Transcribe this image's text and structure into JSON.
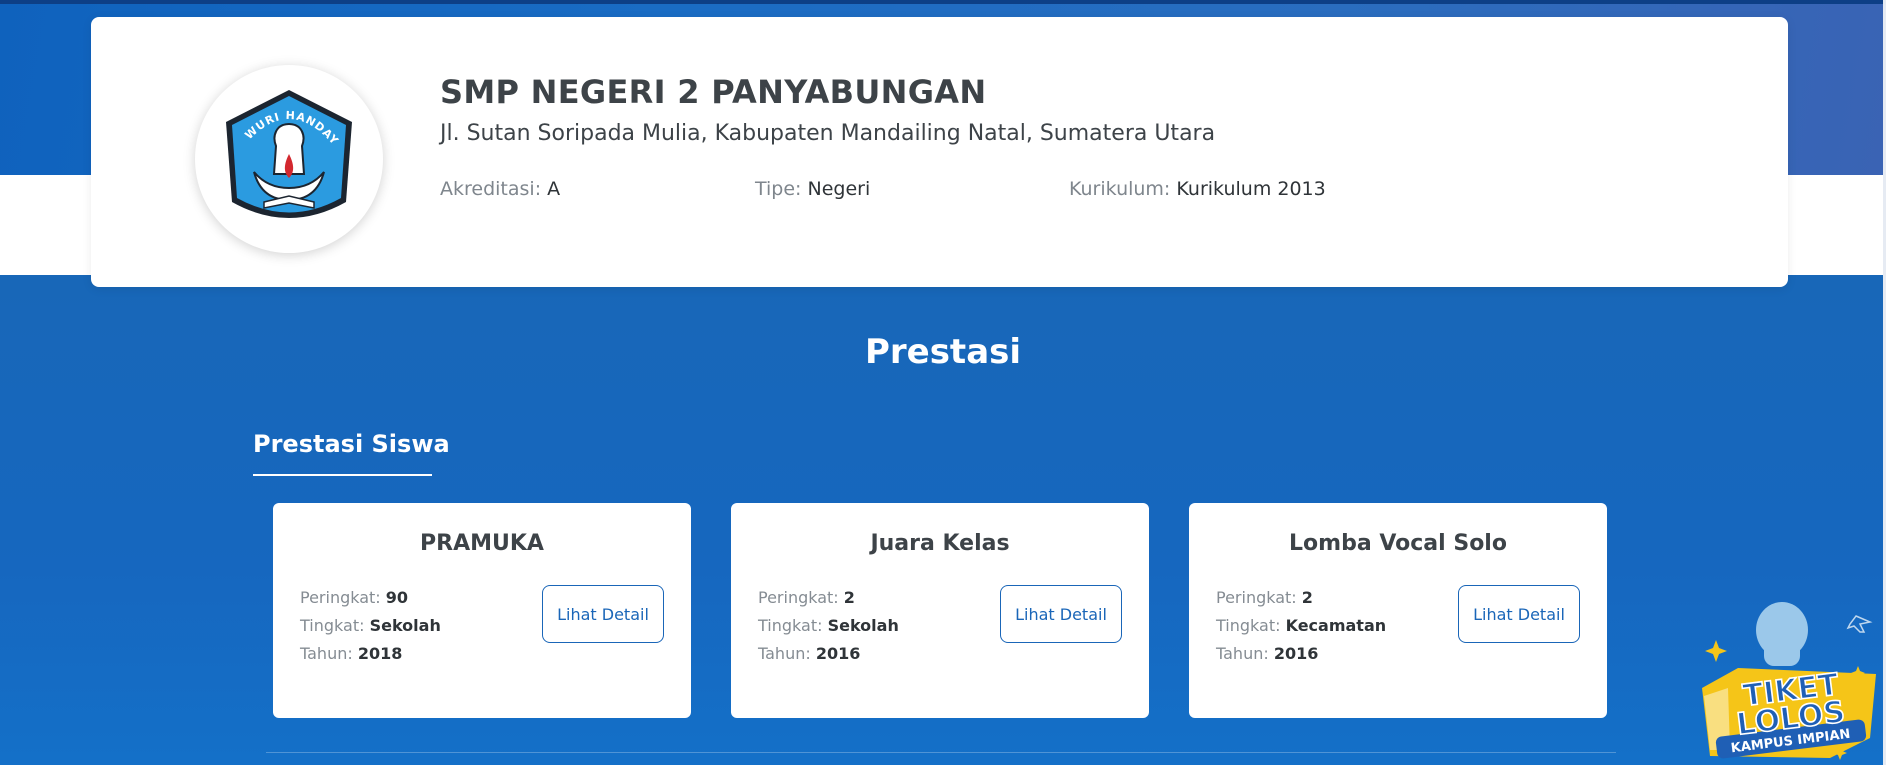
{
  "school": {
    "name": "SMP NEGERI 2 PANYABUNGAN",
    "address": "Jl. Sutan Soripada Mulia, Kabupaten Mandailing Natal, Sumatera Utara",
    "akreditasi_label": "Akreditasi:",
    "akreditasi_value": "A",
    "tipe_label": "Tipe:",
    "tipe_value": "Negeri",
    "kurikulum_label": "Kurikulum:",
    "kurikulum_value": "Kurikulum 2013",
    "logo": {
      "icon": "tut-wuri-handayani-logo",
      "text": "TUT WURI HANDAYANI"
    }
  },
  "section": {
    "title": "Prestasi",
    "tab": "Prestasi Siswa"
  },
  "labels": {
    "peringkat": "Peringkat:",
    "tingkat": "Tingkat:",
    "tahun": "Tahun:",
    "detail_button": "Lihat Detail"
  },
  "achievements": [
    {
      "title": "PRAMUKA",
      "peringkat": "90",
      "tingkat": "Sekolah",
      "tahun": "2018"
    },
    {
      "title": "Juara Kelas",
      "peringkat": "2",
      "tingkat": "Sekolah",
      "tahun": "2016"
    },
    {
      "title": "Lomba Vocal Solo",
      "peringkat": "2",
      "tingkat": "Kecamatan",
      "tahun": "2016"
    }
  ],
  "promo": {
    "line1": "TIKET",
    "line2": "LOLOS",
    "line3": "KAMPUS IMPIAN"
  },
  "colors": {
    "primary_blue": "#1565b8",
    "button_blue": "#1a66b8",
    "text_dark": "#3d4348",
    "badge_yellow": "#f5c518"
  }
}
